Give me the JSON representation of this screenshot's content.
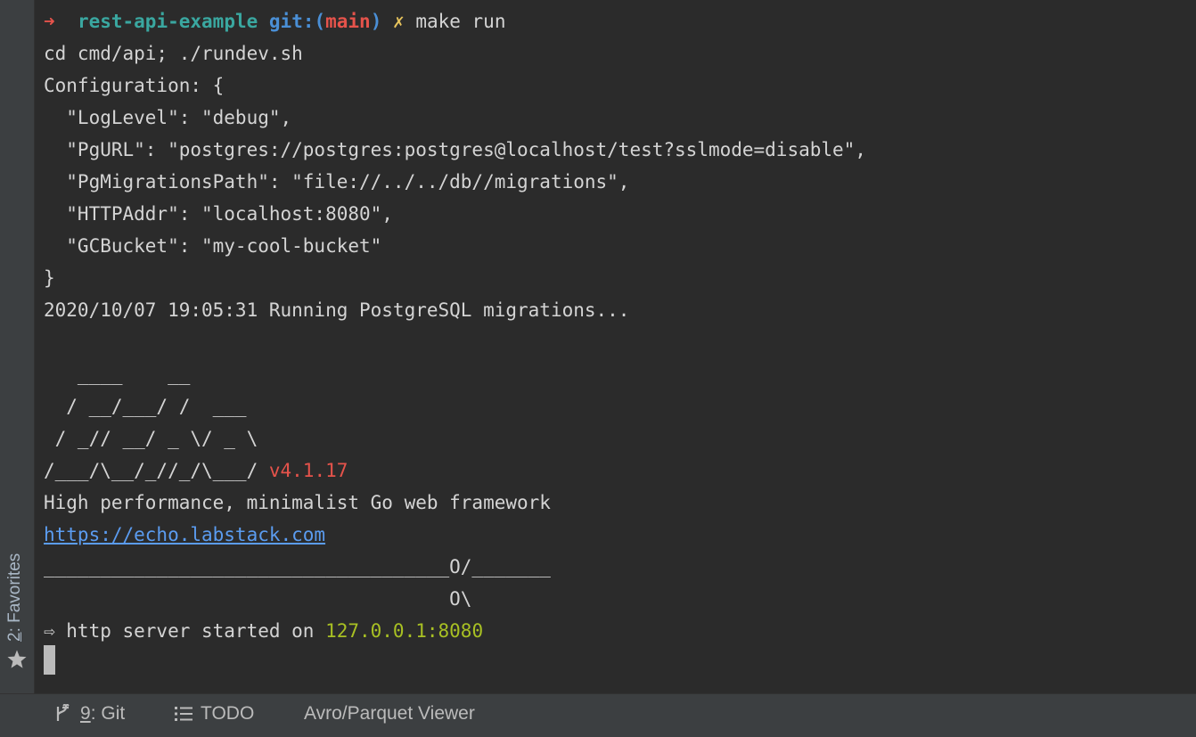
{
  "sidebar": {
    "favorites_num": "2",
    "favorites_rest": ": Favorites",
    "icon": "star-icon"
  },
  "terminal": {
    "prompt": {
      "arrow": "➜",
      "directory": "rest-api-example",
      "git_label": "git:(",
      "branch": "main",
      "git_close": ")",
      "dirty_mark": "✗",
      "command": "make run"
    },
    "lines": [
      "cd cmd/api; ./rundev.sh",
      "Configuration: {",
      "  \"LogLevel\": \"debug\",",
      "  \"PgURL\": \"postgres://postgres:postgres@localhost/test?sslmode=disable\",",
      "  \"PgMigrationsPath\": \"file://../../db//migrations\",",
      "  \"HTTPAddr\": \"localhost:8080\",",
      "  \"GCBucket\": \"my-cool-bucket\"",
      "}",
      "2020/10/07 19:05:31 Running PostgreSQL migrations...",
      "",
      "   ____    __",
      "  / __/___/ /  ___",
      " / _// __/ _ \\/ _ \\",
      "/___/\\__/_//_/\\___/ ",
      "High performance, minimalist Go web framework",
      "https://echo.labstack.com",
      "____________________________________O/_______",
      "                                    O\\",
      "⇨ http server started on "
    ],
    "version": "v4.1.17",
    "server_address": "127.0.0.1:8080"
  },
  "bottombar": {
    "git": {
      "num": "9",
      "rest": ": Git",
      "icon": "git-branch-icon"
    },
    "todo": {
      "label": "TODO",
      "icon": "list-icon"
    },
    "avro": {
      "label": "Avro/Parquet Viewer"
    }
  }
}
